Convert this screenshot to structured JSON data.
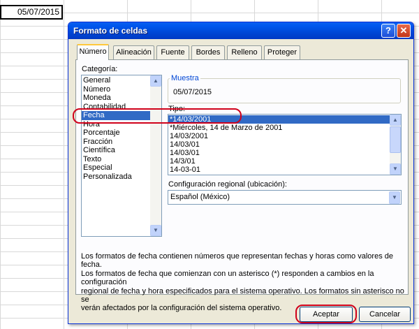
{
  "cell": {
    "value": "05/07/2015"
  },
  "dialog": {
    "title": "Formato de celdas",
    "help_icon": "help-icon",
    "close_icon": "close-icon",
    "tabs": [
      "Número",
      "Alineación",
      "Fuente",
      "Bordes",
      "Relleno",
      "Proteger"
    ],
    "active_tab": "Número"
  },
  "category": {
    "label": "Categoría:",
    "items": [
      "General",
      "Número",
      "Moneda",
      "Contabilidad",
      "Fecha",
      "Hora",
      "Porcentaje",
      "Fracción",
      "Científica",
      "Texto",
      "Especial",
      "Personalizada"
    ],
    "selected": "Fecha"
  },
  "sample": {
    "label": "Muestra",
    "value": "05/07/2015"
  },
  "type": {
    "label": "Tipo:",
    "items": [
      "*14/03/2001",
      "*Miércoles, 14 de Marzo de 2001",
      "14/03/2001",
      "14/03/01",
      "14/03/01",
      "14/3/01",
      "14-03-01"
    ],
    "selected": "*14/03/2001"
  },
  "locale": {
    "label": "Configuración regional (ubicación):",
    "value": "Español (México)"
  },
  "description": {
    "line1": "Los formatos de fecha contienen números que representan fechas y horas como valores de fecha.",
    "line2": "Los formatos de fecha que comienzan con un asterisco (*) responden a cambios en la configuración",
    "line3": "regional de fecha y hora especificados para el sistema operativo. Los formatos sin asterisco no se",
    "line4": "verán afectados por la configuración del sistema operativo."
  },
  "buttons": {
    "ok": "Aceptar",
    "cancel": "Cancelar"
  },
  "colors": {
    "titlebar": "#0054e3",
    "selection": "#316ac5",
    "highlight_oval": "#d0021b",
    "dialog_bg": "#ece9d8"
  }
}
